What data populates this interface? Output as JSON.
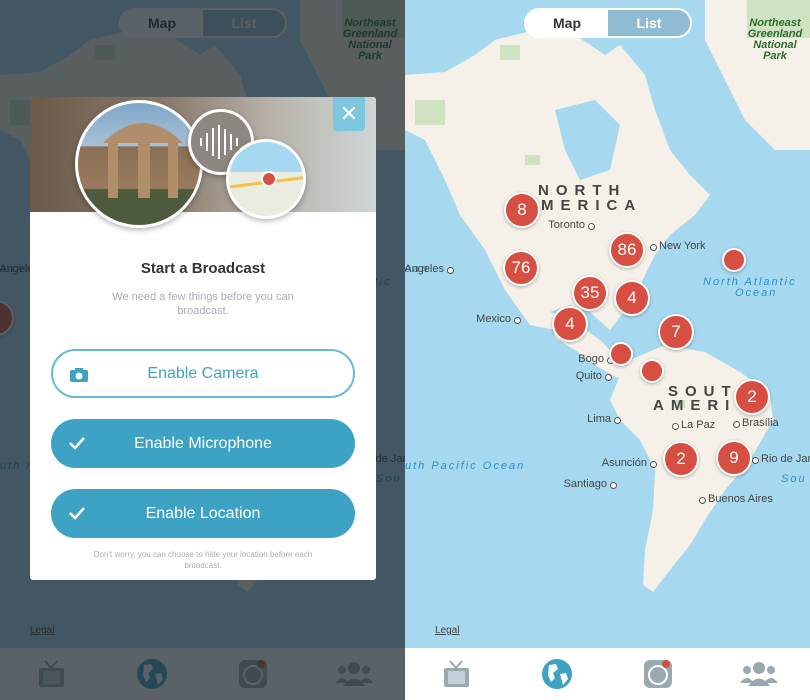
{
  "segmented": {
    "map": "Map",
    "list": "List"
  },
  "map": {
    "park": "Northeast Greenland National Park",
    "continents": {
      "na1": "NORTH",
      "na2": "MERICA",
      "sa1": "SOUT",
      "sa2": "AMERI"
    },
    "oceans": {
      "north_atlantic_1": "North Atlantic",
      "north_atlantic_2": "Ocean",
      "south_pacific": "uth Pacific Ocean",
      "pacific_left": "ean",
      "south_right": "Sou"
    },
    "cities": [
      "Toronto",
      "New York",
      "Los Angeles",
      "Mexico",
      "Bogo",
      "Quito",
      "Lima",
      "La Paz",
      "Brasília",
      "Asunción",
      "Rio de Jane",
      "Santiago",
      "Buenos Aires"
    ],
    "markers": [
      "8",
      "76",
      "86",
      "35",
      "4",
      "4",
      "7",
      "",
      "",
      "",
      "2",
      "2",
      "9"
    ],
    "legal": "Legal",
    "marker_color": "#d64f42"
  },
  "tabs": [
    {
      "icon": "tv-icon",
      "active": false
    },
    {
      "icon": "globe-icon",
      "active": true
    },
    {
      "icon": "broadcast-camera-icon",
      "active": false
    },
    {
      "icon": "people-icon",
      "active": false
    }
  ],
  "modal": {
    "title": "Start a Broadcast",
    "subtitle": "We need a few things before you can broadcast.",
    "buttons": [
      {
        "label": "Enable Camera",
        "icon": "camera-icon",
        "enabled": false
      },
      {
        "label": "Enable Microphone",
        "icon": "check-icon",
        "enabled": true
      },
      {
        "label": "Enable Location",
        "icon": "check-icon",
        "enabled": true
      }
    ],
    "note": "Don't worry, you can choose to hide your location before each broadcast.",
    "close": "✕"
  },
  "colors": {
    "accent": "#3ea2c5",
    "water": "#a6d8f0",
    "land": "#f6f1e8"
  }
}
